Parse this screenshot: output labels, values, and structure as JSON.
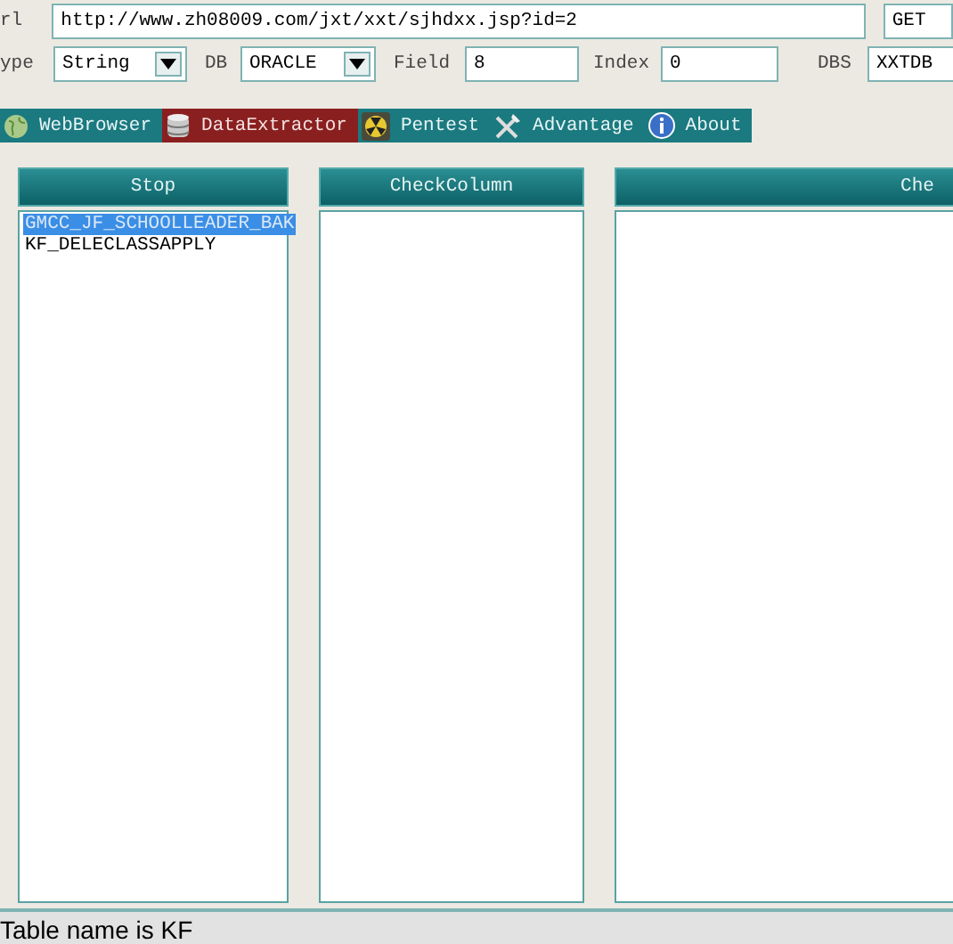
{
  "url": {
    "label": "rl",
    "value": "http://www.zh08009.com/jxt/xxt/sjhdxx.jsp?id=2",
    "method": "GET"
  },
  "options": [
    {
      "kind": "select",
      "label": "ype",
      "value": "String"
    },
    {
      "kind": "select",
      "label": "DB",
      "value": "ORACLE"
    },
    {
      "kind": "input",
      "label": "Field",
      "value": "8"
    },
    {
      "kind": "input",
      "label": "Index",
      "value": "0"
    },
    {
      "kind": "input",
      "label": "DBS",
      "value": "XXTDB"
    }
  ],
  "tabs": [
    {
      "label": "WebBrowser",
      "selected": false
    },
    {
      "label": "DataExtractor",
      "selected": true
    },
    {
      "label": "Pentest",
      "selected": false
    },
    {
      "label": "Advantage",
      "selected": false
    },
    {
      "label": "About",
      "selected": false
    }
  ],
  "panels": [
    {
      "title": "Stop",
      "items": [
        {
          "label": "GMCC_JF_SCHOOLLEADER_BAK",
          "selected": true
        },
        {
          "label": "KF_DELECLASSAPPLY",
          "selected": false
        }
      ]
    },
    {
      "title": "CheckColumn"
    },
    {
      "title": "Che"
    }
  ],
  "status_bar": "Table name is KF"
}
